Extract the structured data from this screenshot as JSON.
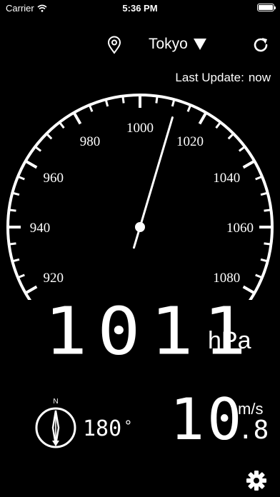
{
  "status_bar": {
    "carrier": "Carrier",
    "time": "5:36 PM",
    "wifi_icon": "wifi-icon",
    "battery_icon": "battery-icon"
  },
  "header": {
    "location_icon": "location-pin-icon",
    "city": "Tokyo",
    "dropdown_icon": "triangle-down-icon",
    "refresh_icon": "refresh-icon"
  },
  "last_update": {
    "label": "Last Update:",
    "value": "now"
  },
  "gauge": {
    "min": 910,
    "max": 1090,
    "labels": [
      "920",
      "940",
      "960",
      "980",
      "1000",
      "1020",
      "1040",
      "1060",
      "1080"
    ],
    "needle_value": 1011
  },
  "pressure": {
    "value": "1011",
    "unit": "hPa"
  },
  "wind": {
    "compass_icon": "compass-icon",
    "north_label": "N",
    "direction_value": "180",
    "direction_unit": "°",
    "direction_degrees": 180,
    "speed_int": "10",
    "speed_frac": ".8",
    "speed_unit": "m/s"
  },
  "footer": {
    "settings_icon": "gear-icon"
  }
}
